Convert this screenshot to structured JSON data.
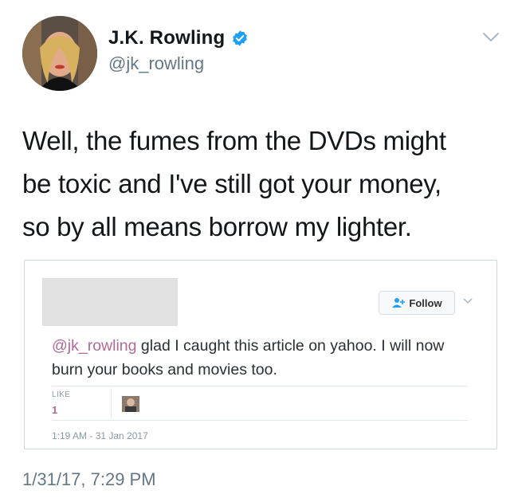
{
  "tweet": {
    "display_name": "J.K. Rowling",
    "handle": "@jk_rowling",
    "verified_icon": "verified-badge-icon",
    "text_lines": [
      "Well, the fumes from the DVDs might",
      "be toxic and I've still got your money,",
      "so by all means borrow my lighter."
    ],
    "timestamp": "1/31/17, 7:29 PM",
    "accent_color": "#1da1f2"
  },
  "embedded": {
    "follow_label": "Follow",
    "mention": "@jk_rowling",
    "text": " glad I caught this article on yahoo. I will now burn your books and movies too.",
    "like_label": "LIKE",
    "like_count": "1",
    "time": "1:19 AM - 31 Jan 2017",
    "mention_color": "#b06a9a"
  }
}
